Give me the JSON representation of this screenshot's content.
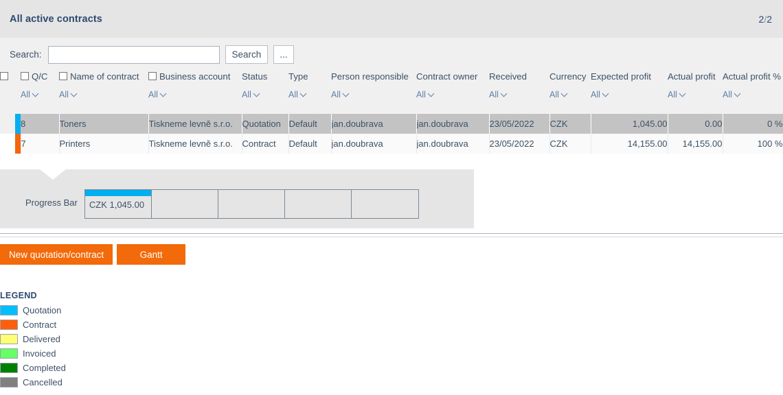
{
  "header": {
    "title": "All active contracts",
    "page_current": "2",
    "page_separator": "/",
    "page_total": "2"
  },
  "search": {
    "label": "Search:",
    "value": "",
    "placeholder": "",
    "search_button": "Search",
    "more_button": "..."
  },
  "table": {
    "filter_all": "All",
    "columns": [
      {
        "label": "",
        "checkbox": true,
        "filter": false
      },
      {
        "label": "Q/C",
        "checkbox": true,
        "filter": true
      },
      {
        "label": "Name of contract",
        "checkbox": true,
        "filter": true
      },
      {
        "label": "Business account",
        "checkbox": true,
        "filter": true
      },
      {
        "label": "Status",
        "checkbox": false,
        "filter": true
      },
      {
        "label": "Type",
        "checkbox": false,
        "filter": true
      },
      {
        "label": "Person responsible",
        "checkbox": false,
        "filter": true
      },
      {
        "label": "Contract owner",
        "checkbox": false,
        "filter": true
      },
      {
        "label": "Received",
        "checkbox": false,
        "filter": true
      },
      {
        "label": "Currency",
        "checkbox": false,
        "filter": true
      },
      {
        "label": "Expected profit",
        "checkbox": false,
        "filter": true
      },
      {
        "label": "Actual profit",
        "checkbox": false,
        "filter": true
      },
      {
        "label": "Actual profit %",
        "checkbox": false,
        "filter": true
      }
    ],
    "rows": [
      {
        "marker_color": "#00b0f0",
        "selected": true,
        "qc": "8",
        "name": "Toners",
        "business_account": "Tiskneme levně s.r.o.",
        "status": "Quotation",
        "type": "Default",
        "person_responsible": "jan.doubrava",
        "contract_owner": "jan.doubrava",
        "received": "23/05/2022",
        "currency": "CZK",
        "expected_profit": "1,045.00",
        "actual_profit": "0.00",
        "actual_profit_pct": "0 %"
      },
      {
        "marker_color": "#f4650c",
        "selected": false,
        "qc": "7",
        "name": "Printers",
        "business_account": "Tiskneme levně s.r.o.",
        "status": "Contract",
        "type": "Default",
        "person_responsible": "jan.doubrava",
        "contract_owner": "jan.doubrava",
        "received": "23/05/2022",
        "currency": "CZK",
        "expected_profit": "14,155.00",
        "actual_profit": "14,155.00",
        "actual_profit_pct": "100 %"
      }
    ]
  },
  "progress_panel": {
    "label": "Progress Bar",
    "cells": [
      {
        "text": "CZK 1,045.00",
        "fill_color": "#00b0f0"
      },
      {
        "text": "",
        "fill_color": ""
      },
      {
        "text": "",
        "fill_color": ""
      },
      {
        "text": "",
        "fill_color": ""
      },
      {
        "text": "",
        "fill_color": ""
      }
    ]
  },
  "actions": {
    "new_contract": "New quotation/contract",
    "gantt": "Gantt",
    "accent_color": "#f26a0a"
  },
  "legend": {
    "title": "LEGEND",
    "items": [
      {
        "label": "Quotation",
        "color": "#00bfff"
      },
      {
        "label": "Contract",
        "color": "#ff5f0a"
      },
      {
        "label": "Delivered",
        "color": "#ffff77"
      },
      {
        "label": "Invoiced",
        "color": "#66ff66"
      },
      {
        "label": "Completed",
        "color": "#008000"
      },
      {
        "label": "Cancelled",
        "color": "#808080"
      }
    ]
  }
}
